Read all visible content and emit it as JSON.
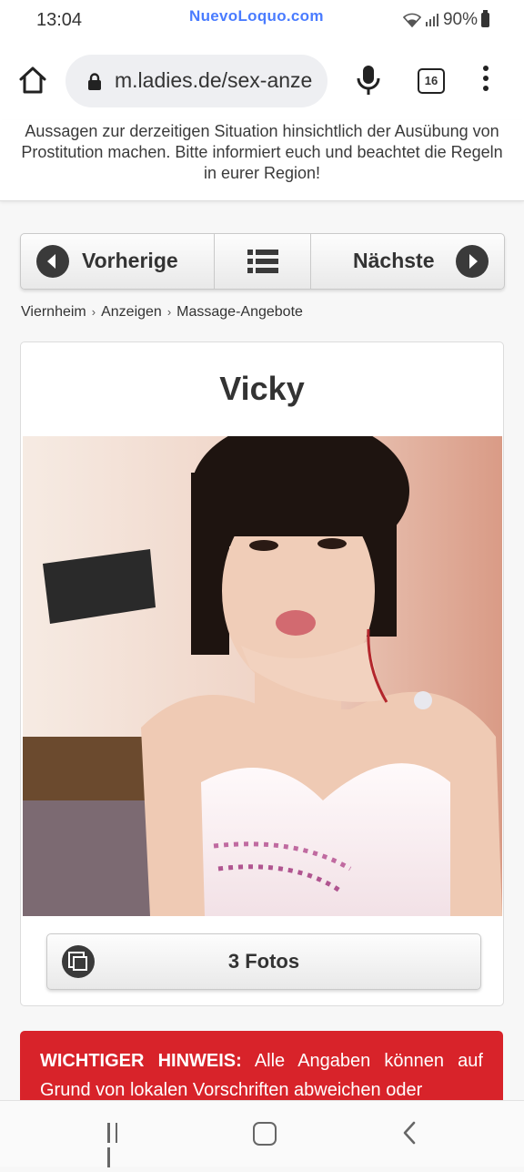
{
  "status_bar": {
    "time": "13:04",
    "watermark": "NuevoLoquo.com",
    "battery": "90%"
  },
  "browser": {
    "url": "m.ladies.de/sex-anze",
    "tab_count": "16",
    "icons": [
      "home-icon",
      "lock-icon",
      "mic-icon",
      "tabs-icon",
      "more-vert-icon"
    ]
  },
  "notice": {
    "text": "Aussagen zur derzeitigen Situation hinsichtlich der Ausübung von Prostitution machen. Bitte informiert euch und beachtet die Regeln in eurer Region!"
  },
  "nav": {
    "prev_label": "Vorherige",
    "next_label": "Nächste"
  },
  "breadcrumb": [
    "Viernheim",
    "Anzeigen",
    "Massage-Angebote"
  ],
  "ad": {
    "title": "Vicky",
    "photos_label": "3 Fotos"
  },
  "warning": {
    "heading": "WICHTIGER HINWEIS:",
    "text": " Alle Angaben können auf Grund von lokalen Vorschriften abweichen oder"
  },
  "colors": {
    "accent_red": "#d8232a",
    "watermark_blue": "#4a7cff",
    "button_dark": "#3a3a3a"
  }
}
